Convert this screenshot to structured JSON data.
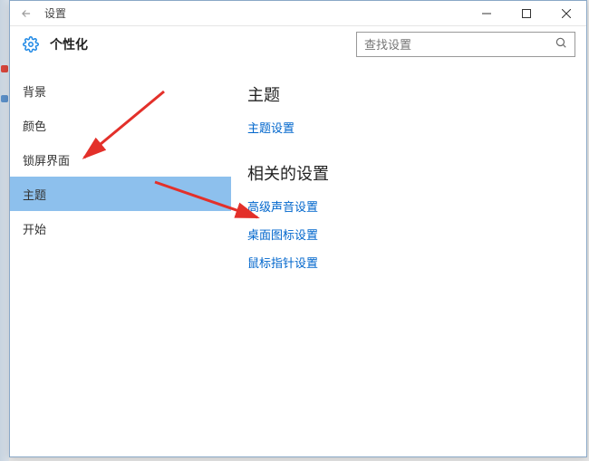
{
  "window": {
    "title": "设置"
  },
  "header": {
    "page_title": "个性化",
    "search_placeholder": "查找设置"
  },
  "sidebar": {
    "items": [
      {
        "label": "背景",
        "selected": false
      },
      {
        "label": "颜色",
        "selected": false
      },
      {
        "label": "锁屏界面",
        "selected": false
      },
      {
        "label": "主题",
        "selected": true
      },
      {
        "label": "开始",
        "selected": false
      }
    ]
  },
  "content": {
    "section1": {
      "title": "主题",
      "links": [
        {
          "label": "主题设置"
        }
      ]
    },
    "section2": {
      "title": "相关的设置",
      "links": [
        {
          "label": "高级声音设置"
        },
        {
          "label": "桌面图标设置"
        },
        {
          "label": "鼠标指针设置"
        }
      ]
    }
  }
}
